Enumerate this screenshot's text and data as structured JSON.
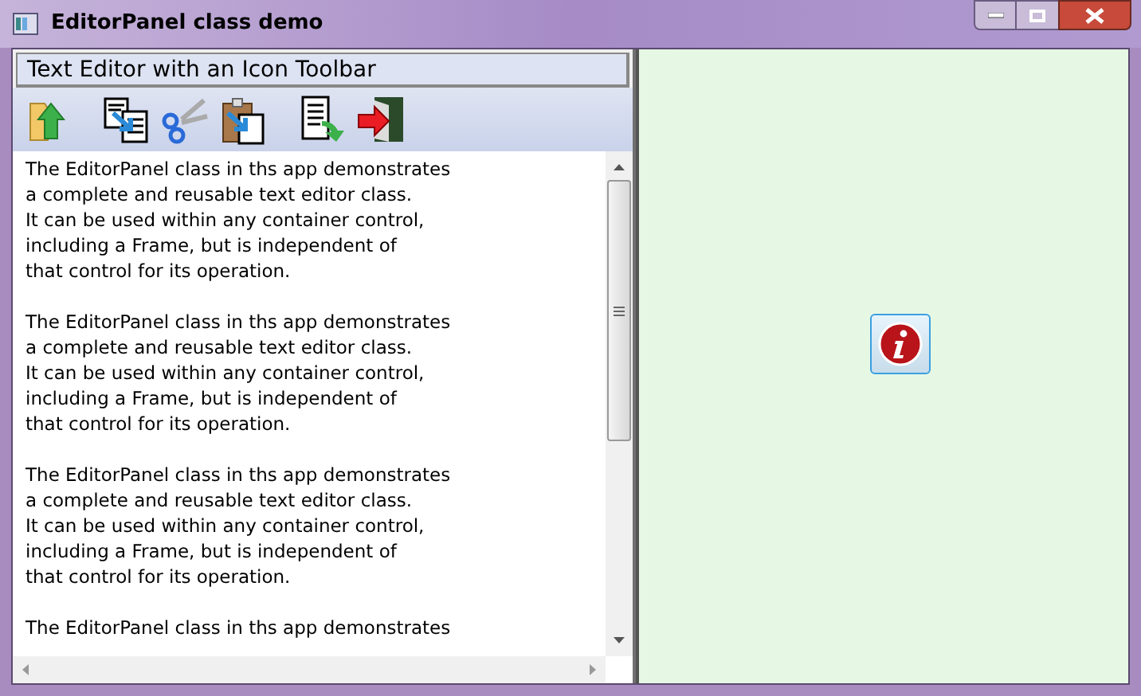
{
  "window": {
    "title": "EditorPanel class demo"
  },
  "panel": {
    "title": "Text Editor with an Icon Toolbar"
  },
  "toolbar": [
    {
      "kind": "open"
    },
    {
      "kind": "copy"
    },
    {
      "kind": "cut"
    },
    {
      "kind": "paste"
    },
    {
      "kind": "save"
    },
    {
      "kind": "exit"
    }
  ],
  "editor": {
    "paragraphs": [
      [
        "The EditorPanel class in ths app demonstrates",
        "a complete and reusable text editor class.",
        "It can be used within any container control,",
        "including a Frame, but is independent of",
        "that control for its operation."
      ],
      [
        "The EditorPanel class in ths app demonstrates",
        "a complete and reusable text editor class.",
        "It can be used within any container control,",
        "including a Frame, but is independent of",
        "that control for its operation."
      ],
      [
        "The EditorPanel class in ths app demonstrates",
        "a complete and reusable text editor class.",
        "It can be used within any container control,",
        "including a Frame, but is independent of",
        "that control for its operation."
      ],
      [
        "The EditorPanel class in ths app demonstrates"
      ]
    ]
  }
}
